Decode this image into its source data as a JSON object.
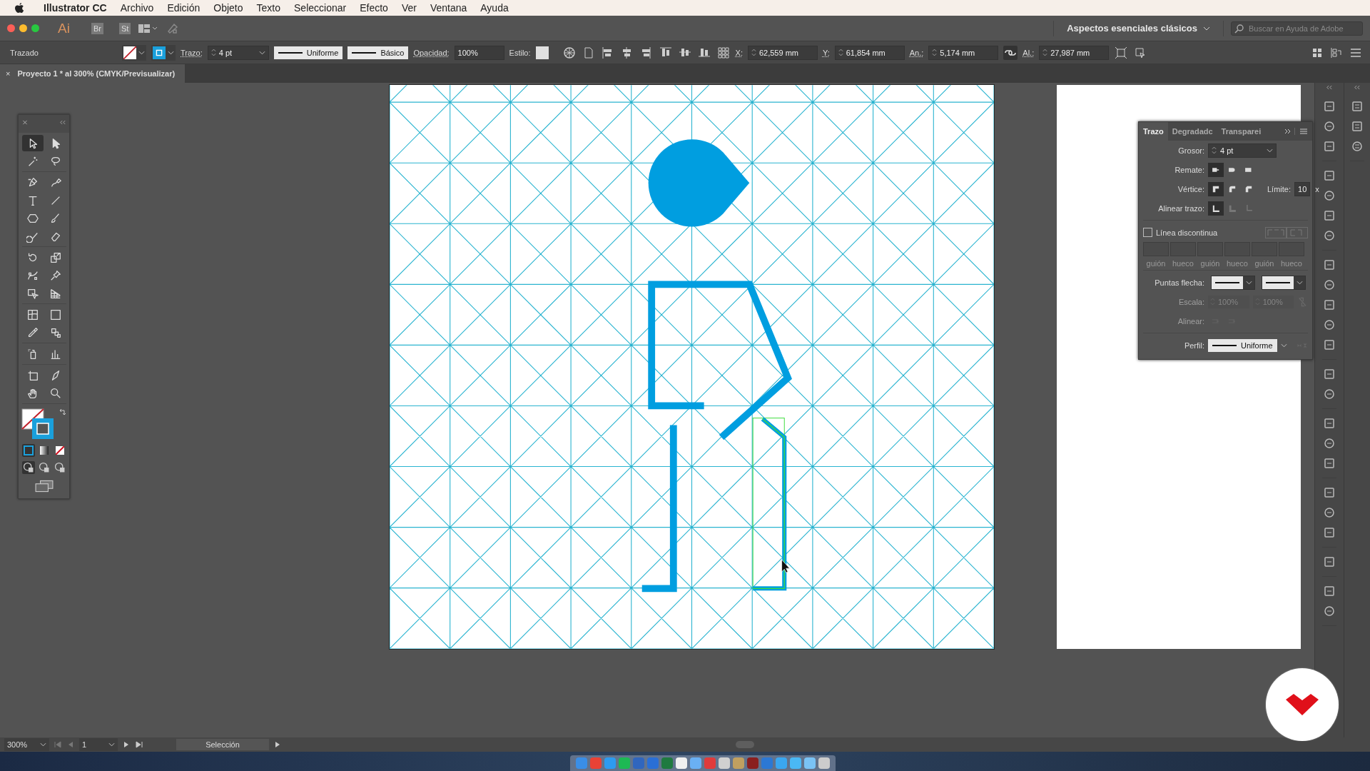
{
  "menu_bar": {
    "app_name": "Illustrator CC",
    "items": [
      "Archivo",
      "Edición",
      "Objeto",
      "Texto",
      "Seleccionar",
      "Efecto",
      "Ver",
      "Ventana",
      "Ayuda"
    ]
  },
  "app_bar": {
    "logo": "Ai",
    "bridge": "Br",
    "stock": "St",
    "workspace": "Aspectos esenciales clásicos",
    "search": {
      "placeholder": "Buscar en Ayuda de Adobe"
    }
  },
  "control_bar": {
    "selection_type": "Trazado",
    "stroke_label": "Trazo:",
    "stroke_weight": "4 pt",
    "variable_width": "Uniforme",
    "brush": "Básico",
    "opacity_label": "Opacidad:",
    "opacity": "100%",
    "style_label": "Estilo:",
    "transform": [
      {
        "label": "X:",
        "value": "62,559 mm"
      },
      {
        "label": "Y:",
        "value": "61,854 mm"
      },
      {
        "label": "An.:",
        "value": "5,174 mm"
      },
      {
        "label": "Al.:",
        "value": "27,987 mm"
      }
    ]
  },
  "document_tab": {
    "close": "×",
    "title": "Proyecto 1 * al 300% (CMYK/Previsualizar)"
  },
  "tools": [
    [
      {
        "kind": "selection",
        "selected": true
      },
      {
        "kind": "direct-selection",
        "selected": false
      },
      {
        "kind": "magic-wand",
        "selected": false
      },
      {
        "kind": "lasso",
        "selected": false
      }
    ],
    [
      {
        "kind": "pen",
        "selected": false
      },
      {
        "kind": "curvature",
        "selected": false
      },
      {
        "kind": "type",
        "selected": false
      },
      {
        "kind": "line",
        "selected": false
      },
      {
        "kind": "shape",
        "selected": false
      },
      {
        "kind": "paintbrush",
        "selected": false
      },
      {
        "kind": "shaper",
        "selected": false
      },
      {
        "kind": "eraser",
        "selected": false
      }
    ],
    [
      {
        "kind": "rotate",
        "selected": false
      },
      {
        "kind": "scale",
        "selected": false
      },
      {
        "kind": "puppet-warp",
        "selected": false
      },
      {
        "kind": "pin",
        "selected": false
      },
      {
        "kind": "shape-builder",
        "selected": false
      },
      {
        "kind": "perspective",
        "selected": false
      }
    ],
    [
      {
        "kind": "mesh",
        "selected": false
      },
      {
        "kind": "gradient",
        "selected": false
      },
      {
        "kind": "eyedropper",
        "selected": false
      },
      {
        "kind": "blend",
        "selected": false
      }
    ],
    [
      {
        "kind": "symbol-sprayer",
        "selected": false
      },
      {
        "kind": "column-graph",
        "selected": false
      }
    ],
    [
      {
        "kind": "artboard",
        "selected": false
      },
      {
        "kind": "knife",
        "selected": false
      },
      {
        "kind": "hand",
        "selected": false
      },
      {
        "kind": "zoom",
        "selected": false
      }
    ]
  ],
  "stroke_panel": {
    "tabs": [
      {
        "label": "Trazo",
        "selected": true
      },
      {
        "label": "Degradadc",
        "selected": false
      },
      {
        "label": "Transparei",
        "selected": false
      }
    ],
    "weight": {
      "label": "Grosor:",
      "value": "4 pt"
    },
    "cap": {
      "label": "Remate:",
      "options": [
        {
          "kind": "butt",
          "selected": true,
          "disabled": false
        },
        {
          "kind": "round",
          "selected": false,
          "disabled": false
        },
        {
          "kind": "square",
          "selected": false,
          "disabled": false
        }
      ]
    },
    "corner": {
      "label": "Vértice:",
      "options": [
        {
          "kind": "miter",
          "selected": true,
          "disabled": false
        },
        {
          "kind": "round",
          "selected": false,
          "disabled": false
        },
        {
          "kind": "bevel",
          "selected": false,
          "disabled": false
        }
      ],
      "limit_label": "Límite:",
      "limit": "10",
      "limit_unit": "x"
    },
    "align": {
      "label": "Alinear trazo:",
      "options": [
        {
          "kind": "center",
          "selected": true,
          "disabled": false
        },
        {
          "kind": "inside",
          "selected": false,
          "disabled": true
        },
        {
          "kind": "outside",
          "selected": false,
          "disabled": true
        }
      ]
    },
    "dashed": {
      "label": "Línea discontinua",
      "checked": false
    },
    "dash_fields": [
      {
        "label": "guión"
      },
      {
        "label": "hueco"
      },
      {
        "label": "guión"
      },
      {
        "label": "hueco"
      },
      {
        "label": "guión"
      },
      {
        "label": "hueco"
      }
    ],
    "arrowheads": {
      "label": "Puntas flecha:"
    },
    "scale": {
      "label": "Escala:",
      "values": [
        "100%",
        "100%"
      ],
      "disabled": true
    },
    "arrow_align": {
      "label": "Alinear:",
      "disabled": true
    },
    "profile": {
      "label": "Perfil:",
      "value": "Uniforme"
    }
  },
  "status_bar": {
    "zoom": "300%",
    "artboard": "1",
    "tool": "Selección"
  }
}
